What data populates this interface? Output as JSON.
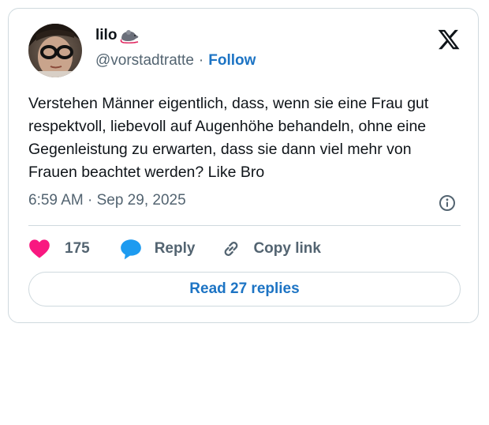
{
  "author": {
    "display_name": "lilo",
    "name_emoji": "rat-emoji",
    "handle": "@vorstadtratte",
    "separator": "·",
    "follow_label": "Follow"
  },
  "tweet": {
    "text": "Verstehen Männer eigentlich, dass, wenn sie eine Frau gut respektvoll, liebevoll auf Augenhöhe behandeln, ohne eine Gegenleistung zu erwarten, dass sie dann viel mehr von Frauen beachtet werden? Like Bro",
    "timestamp": "6:59 AM · Sep 29, 2025"
  },
  "actions": {
    "like_count": "175",
    "reply_label": "Reply",
    "copy_link_label": "Copy link"
  },
  "read_replies_label": "Read 27 replies",
  "icons": [
    "x-logo-icon",
    "info-icon",
    "heart-icon",
    "reply-bubble-icon",
    "link-icon"
  ],
  "colors": {
    "like": "#f91880",
    "reply": "#1d9bf0",
    "link_text": "#1d74c4",
    "secondary_text": "#536471",
    "border": "#cfd9de"
  }
}
